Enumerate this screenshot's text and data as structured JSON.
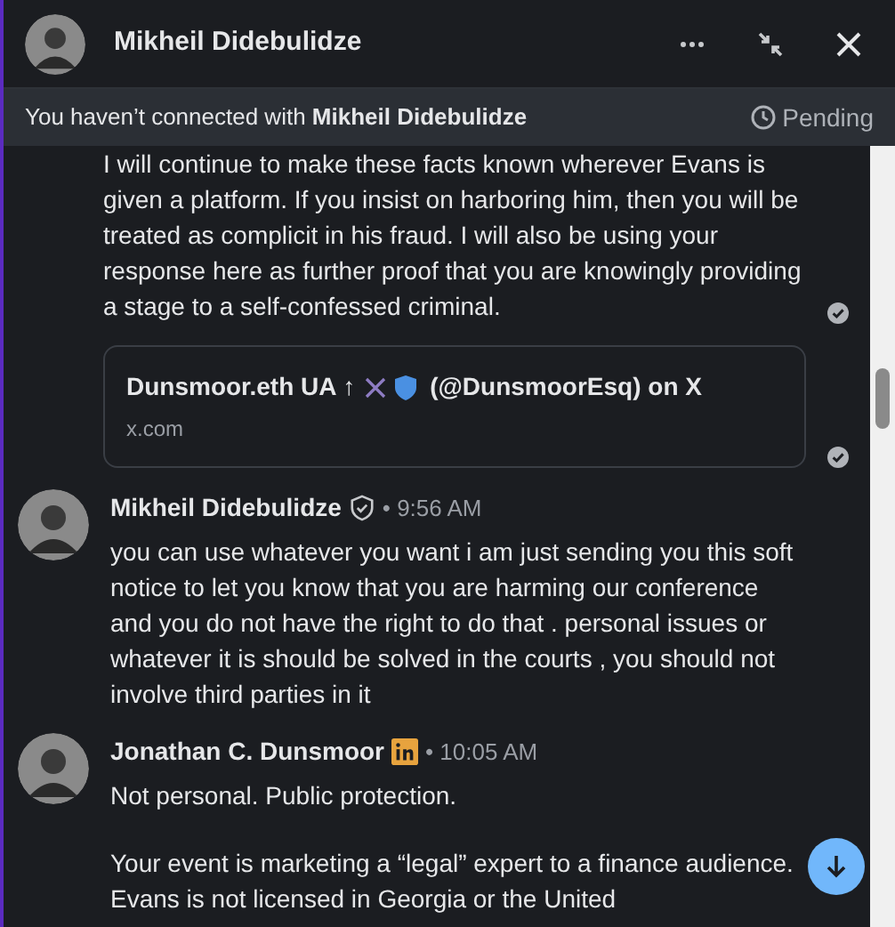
{
  "header": {
    "name": "Mikheil Didebulidze"
  },
  "banner": {
    "text": "You haven’t connected with ",
    "name": "Mikheil Didebulidze",
    "status": "Pending"
  },
  "messages": [
    {
      "kind": "text",
      "paragraphs": [
        "I will continue to make these facts known wherever Evans is given a platform. If you insist on harboring him, then you will be treated as complicit in his fraud. I will also be using your response here as further proof that you are knowingly providing a stage to a self-confessed criminal."
      ],
      "read": true
    },
    {
      "kind": "link",
      "title_before": "Dunsmoor.eth UA ↑",
      "title_after": "(@DunsmoorEsq) on X",
      "domain": "x.com",
      "read": true
    },
    {
      "kind": "author",
      "name": "Mikheil Didebulidze",
      "badge": {
        "kind": "shield"
      },
      "time": "• 9:56 AM",
      "paragraphs": [
        "you can use whatever you want i am just sending you this soft notice to let you know that you are harming our conference and you do not have the right to do that . personal issues or whatever it is should be solved in the courts , you should not involve third parties in it"
      ]
    },
    {
      "kind": "author",
      "name": "Jonathan C. Dunsmoor",
      "badge": {
        "kind": "linkedin"
      },
      "time": "• 10:05 AM",
      "paragraphs": [
        "Not personal. Public protection.",
        "Your event is marketing a “legal” expert to a finance audience. Evans is not licensed in Georgia or the United"
      ]
    }
  ]
}
